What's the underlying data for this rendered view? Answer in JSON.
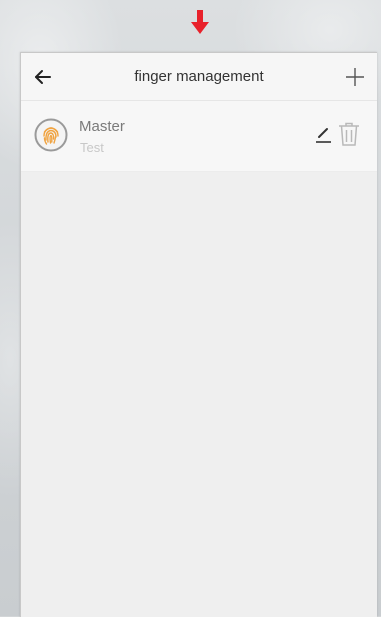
{
  "header": {
    "title": "finger management",
    "back_icon": "arrow-left-icon",
    "add_icon": "plus-icon"
  },
  "fingers": [
    {
      "name": "Master",
      "subtitle": "Test",
      "icon": "fingerprint-icon",
      "edit_icon": "pencil-icon",
      "delete_icon": "trash-icon"
    }
  ],
  "colors": {
    "indicator_arrow": "#e8212b",
    "fingerprint": "#f0a340",
    "background": "#efefef"
  }
}
